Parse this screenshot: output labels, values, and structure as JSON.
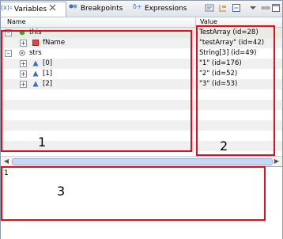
{
  "tabs": [
    {
      "label": "Variables",
      "icon": "variables-icon"
    },
    {
      "label": "Breakpoints",
      "icon": "breakpoints-icon"
    },
    {
      "label": "Expressions",
      "icon": "expressions-icon"
    }
  ],
  "columns": {
    "name": "Name",
    "value": "Value"
  },
  "rows": [
    {
      "name": "this",
      "value": "TestArray  (id=28)"
    },
    {
      "name": "fName",
      "value": "\"testArray\" (id=42)"
    },
    {
      "name": "strs",
      "value": "String[3]  (id=49)"
    },
    {
      "name": "[0]",
      "value": "\"1\" (id=176)"
    },
    {
      "name": "[1]",
      "value": "\"2\" (id=52)"
    },
    {
      "name": "[2]",
      "value": "\"3\" (id=53)"
    }
  ],
  "detail": {
    "text": "1"
  },
  "annotations": [
    "1",
    "2",
    "3"
  ],
  "colors": {
    "annotation": "#e0101a",
    "selection": "#ebebe3"
  }
}
